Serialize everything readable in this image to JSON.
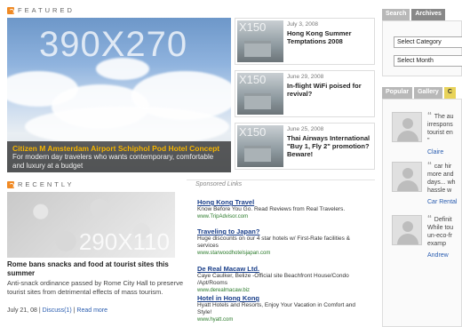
{
  "featured": {
    "heading": "FEATURED",
    "main": {
      "image_size": "390X270",
      "title": "Citizen M Amsterdam Airport Schiphol Pod Hotel Concept",
      "description": "For modern day travelers who wants contemporary, comfortable and luxury at a budget"
    },
    "items": [
      {
        "thumb_size": "X150",
        "date": "July 3, 2008",
        "title": "Hong Kong Summer Temptations 2008"
      },
      {
        "thumb_size": "X150",
        "date": "June 29, 2008",
        "title": "In-flight WiFi poised for revival?"
      },
      {
        "thumb_size": "X150",
        "date": "June 25, 2008",
        "title": "Thai Airways International \"Buy 1, Fly 2\" promotion? Beware!"
      }
    ]
  },
  "recent": {
    "heading": "RECENTLY",
    "image_size": "290X110",
    "title": "Rome bans snacks and food at tourist sites this summer",
    "description": "Anti-snack ordinance passed by Rome City Hall to preserve tourist sites from detrimental effects of mass tourism.",
    "date": "July 21, 08",
    "discuss_label": "Discuss(1)",
    "read_more_label": "Read more",
    "separator": "|"
  },
  "sponsored": {
    "heading": "Sponsored Links",
    "ads": [
      {
        "title": "Hong Kong Travel",
        "text": "Know Before You Go. Read Reviews from Real Travelers.",
        "url": "www.TripAdvisor.com"
      },
      {
        "title": "Traveling to Japan?",
        "text": "Huge discounts on our 4 star hotels w/ First-Rate facilities & services",
        "url": "www.starwoodhotelsjapan.com"
      },
      {
        "title": "De Real Macaw Ltd.",
        "text": "Caye Caulker, Belize -Official site Beachfront House/Condo /Apt/Rooms",
        "url": "www.derealmacaw.biz"
      },
      {
        "title": "Hotel in Hong Kong",
        "text": "Hyatt Hotels and Resorts, Enjoy Your Vacation in Comfort and Style!",
        "url": "www.hyatt.com"
      }
    ]
  },
  "sidebar": {
    "tabs": [
      "Search",
      "Archives"
    ],
    "active_tab": "Archives",
    "select_category": "Select Category",
    "select_month": "Select Month",
    "tabs2": [
      "Popular",
      "Gallery",
      "C"
    ],
    "comments": [
      {
        "text": "The au\nirrespons\ntourist en\n\"",
        "author": "Claire"
      },
      {
        "text": "car hir\nmore and\ndays... wh\nhassle w",
        "author": "Car Rental"
      },
      {
        "text": "Definit\nWhile tou\nun-eco-fr\nexamp",
        "author": "Andrew"
      }
    ]
  }
}
